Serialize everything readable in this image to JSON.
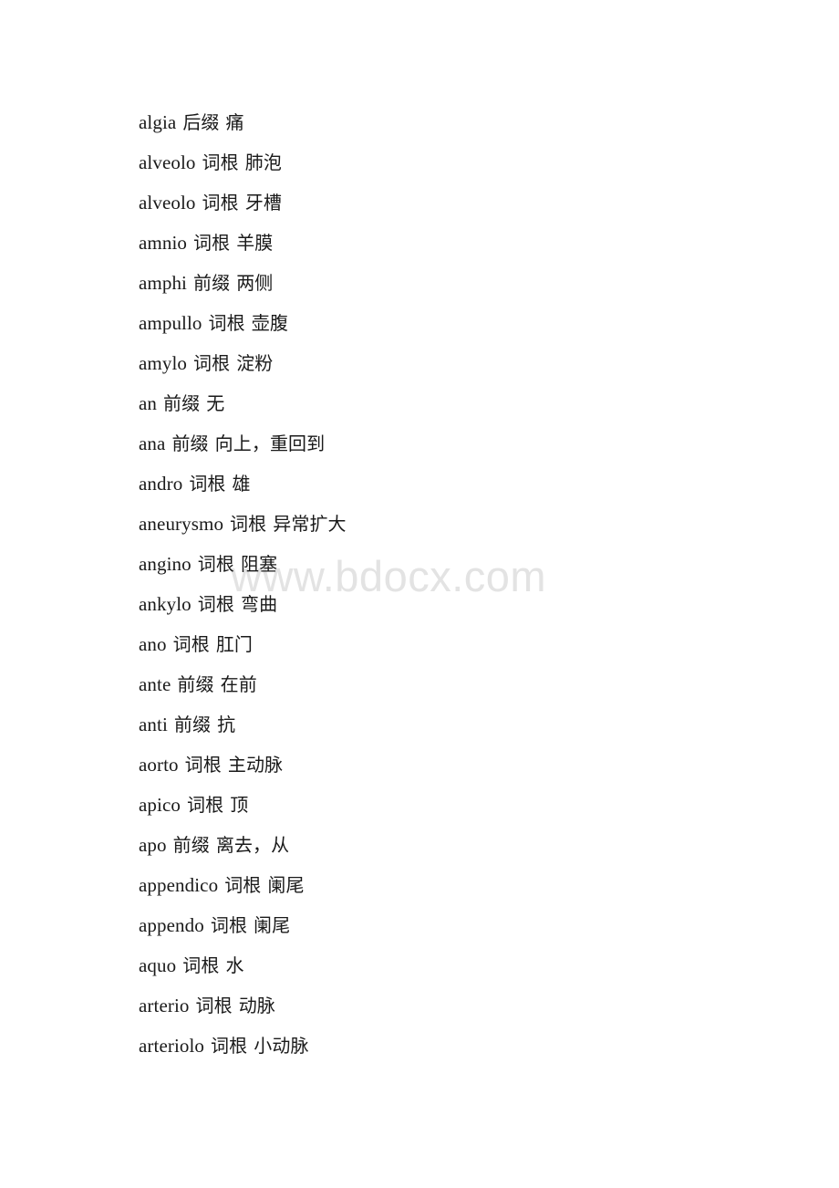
{
  "page": {
    "background_color": "#ffffff",
    "text_color": "#1a1a1a"
  },
  "watermark": {
    "text": "www.bdocx.com",
    "color": "#e3e3e3"
  },
  "glossary": {
    "entries": [
      {
        "morpheme": "algia",
        "category": "后缀",
        "gloss": "痛"
      },
      {
        "morpheme": "alveolo",
        "category": "词根",
        "gloss": "肺泡"
      },
      {
        "morpheme": "alveolo",
        "category": "词根",
        "gloss": "牙槽"
      },
      {
        "morpheme": "amnio",
        "category": "词根",
        "gloss": "羊膜"
      },
      {
        "morpheme": "amphi",
        "category": "前缀",
        "gloss": "两侧"
      },
      {
        "morpheme": "ampullo",
        "category": "词根",
        "gloss": "壶腹"
      },
      {
        "morpheme": "amylo",
        "category": "词根",
        "gloss": "淀粉"
      },
      {
        "morpheme": "an",
        "category": "前缀",
        "gloss": "无"
      },
      {
        "morpheme": "ana",
        "category": "前缀",
        "gloss": "向上，重回到"
      },
      {
        "morpheme": "andro",
        "category": "词根",
        "gloss": "雄"
      },
      {
        "morpheme": "aneurysmo",
        "category": "词根",
        "gloss": "异常扩大"
      },
      {
        "morpheme": "angino",
        "category": "词根",
        "gloss": "阻塞"
      },
      {
        "morpheme": "ankylo",
        "category": "词根",
        "gloss": "弯曲"
      },
      {
        "morpheme": "ano",
        "category": "词根",
        "gloss": "肛门"
      },
      {
        "morpheme": "ante",
        "category": "前缀",
        "gloss": "在前"
      },
      {
        "morpheme": "anti",
        "category": "前缀",
        "gloss": "抗"
      },
      {
        "morpheme": "aorto",
        "category": "词根",
        "gloss": "主动脉"
      },
      {
        "morpheme": "apico",
        "category": "词根",
        "gloss": "顶"
      },
      {
        "morpheme": "apo",
        "category": "前缀",
        "gloss": "离去，从"
      },
      {
        "morpheme": "appendico",
        "category": "词根",
        "gloss": "阑尾"
      },
      {
        "morpheme": "appendo",
        "category": "词根",
        "gloss": "阑尾"
      },
      {
        "morpheme": "aquo",
        "category": "词根",
        "gloss": "水"
      },
      {
        "morpheme": "arterio",
        "category": "词根",
        "gloss": "动脉"
      },
      {
        "morpheme": "arteriolo",
        "category": "词根",
        "gloss": "小动脉"
      }
    ]
  }
}
